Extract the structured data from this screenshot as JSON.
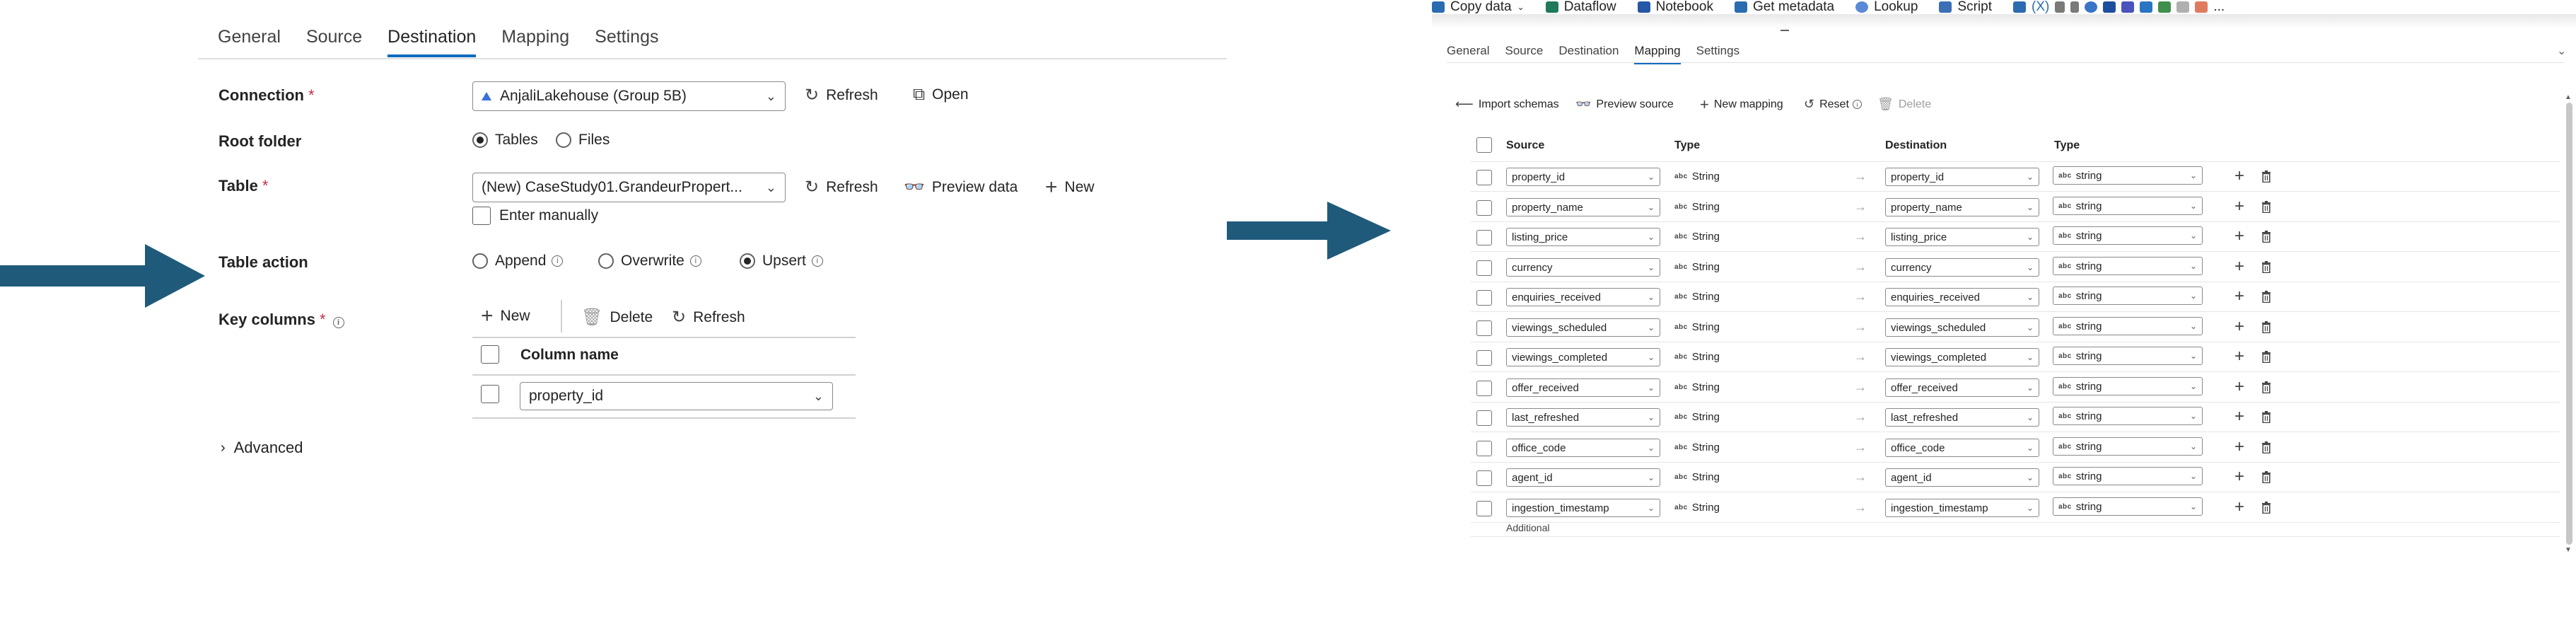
{
  "left": {
    "tabs": [
      "General",
      "Source",
      "Destination",
      "Mapping",
      "Settings"
    ],
    "connection": {
      "label": "Connection",
      "required_mark": "*",
      "value": "AnjaliLakehouse (Group 5B)",
      "refresh": "Refresh",
      "open": "Open"
    },
    "root_folder": {
      "label": "Root folder",
      "options": [
        "Tables",
        "Files"
      ],
      "selected": "Tables"
    },
    "table": {
      "label": "Table",
      "required_mark": "*",
      "value": "(New) CaseStudy01.GrandeurPropert...",
      "refresh": "Refresh",
      "preview": "Preview data",
      "new": "New",
      "enter_manually": "Enter manually"
    },
    "table_action": {
      "label": "Table action",
      "options": [
        "Append",
        "Overwrite",
        "Upsert"
      ],
      "selected": "Upsert"
    },
    "key_columns": {
      "label": "Key columns",
      "required_mark": "*",
      "new": "New",
      "delete": "Delete",
      "refresh": "Refresh",
      "column_header": "Column name",
      "value": "property_id"
    },
    "advanced": "Advanced"
  },
  "right": {
    "toolbar": [
      "Copy data",
      "Dataflow",
      "Notebook",
      "Get metadata",
      "Lookup",
      "Script"
    ],
    "toolbar_fx": "(X)",
    "toolbar_more": "...",
    "tabs": [
      "General",
      "Source",
      "Destination",
      "Mapping",
      "Settings"
    ],
    "actions": {
      "import": "Import schemas",
      "preview": "Preview source",
      "new_mapping": "New mapping",
      "reset": "Reset",
      "delete": "Delete"
    },
    "headers": {
      "source": "Source",
      "type": "Type",
      "destination": "Destination",
      "dest_type": "Type"
    },
    "rows": [
      {
        "source": "property_id",
        "type": "String",
        "dest": "property_id",
        "dest_type": "string"
      },
      {
        "source": "property_name",
        "type": "String",
        "dest": "property_name",
        "dest_type": "string"
      },
      {
        "source": "listing_price",
        "type": "String",
        "dest": "listing_price",
        "dest_type": "string"
      },
      {
        "source": "currency",
        "type": "String",
        "dest": "currency",
        "dest_type": "string"
      },
      {
        "source": "enquiries_received",
        "type": "String",
        "dest": "enquiries_received",
        "dest_type": "string"
      },
      {
        "source": "viewings_scheduled",
        "type": "String",
        "dest": "viewings_scheduled",
        "dest_type": "string"
      },
      {
        "source": "viewings_completed",
        "type": "String",
        "dest": "viewings_completed",
        "dest_type": "string"
      },
      {
        "source": "offer_received",
        "type": "String",
        "dest": "offer_received",
        "dest_type": "string"
      },
      {
        "source": "last_refreshed",
        "type": "String",
        "dest": "last_refreshed",
        "dest_type": "string"
      },
      {
        "source": "office_code",
        "type": "String",
        "dest": "office_code",
        "dest_type": "string"
      },
      {
        "source": "agent_id",
        "type": "String",
        "dest": "agent_id",
        "dest_type": "string"
      },
      {
        "source": "ingestion_timestamp",
        "type": "String",
        "dest": "ingestion_timestamp",
        "dest_type": "string"
      }
    ],
    "type_badge": "abc",
    "additional": "Additional"
  },
  "colors": {
    "arrow": "#1f5a7a",
    "accent": "#0f6cbd"
  },
  "icons": [
    "refresh-icon",
    "open-icon",
    "preview-icon",
    "plus-icon",
    "trash-icon",
    "info-icon",
    "chevron-down-icon",
    "lakehouse-icon",
    "arrow-right-icon"
  ]
}
